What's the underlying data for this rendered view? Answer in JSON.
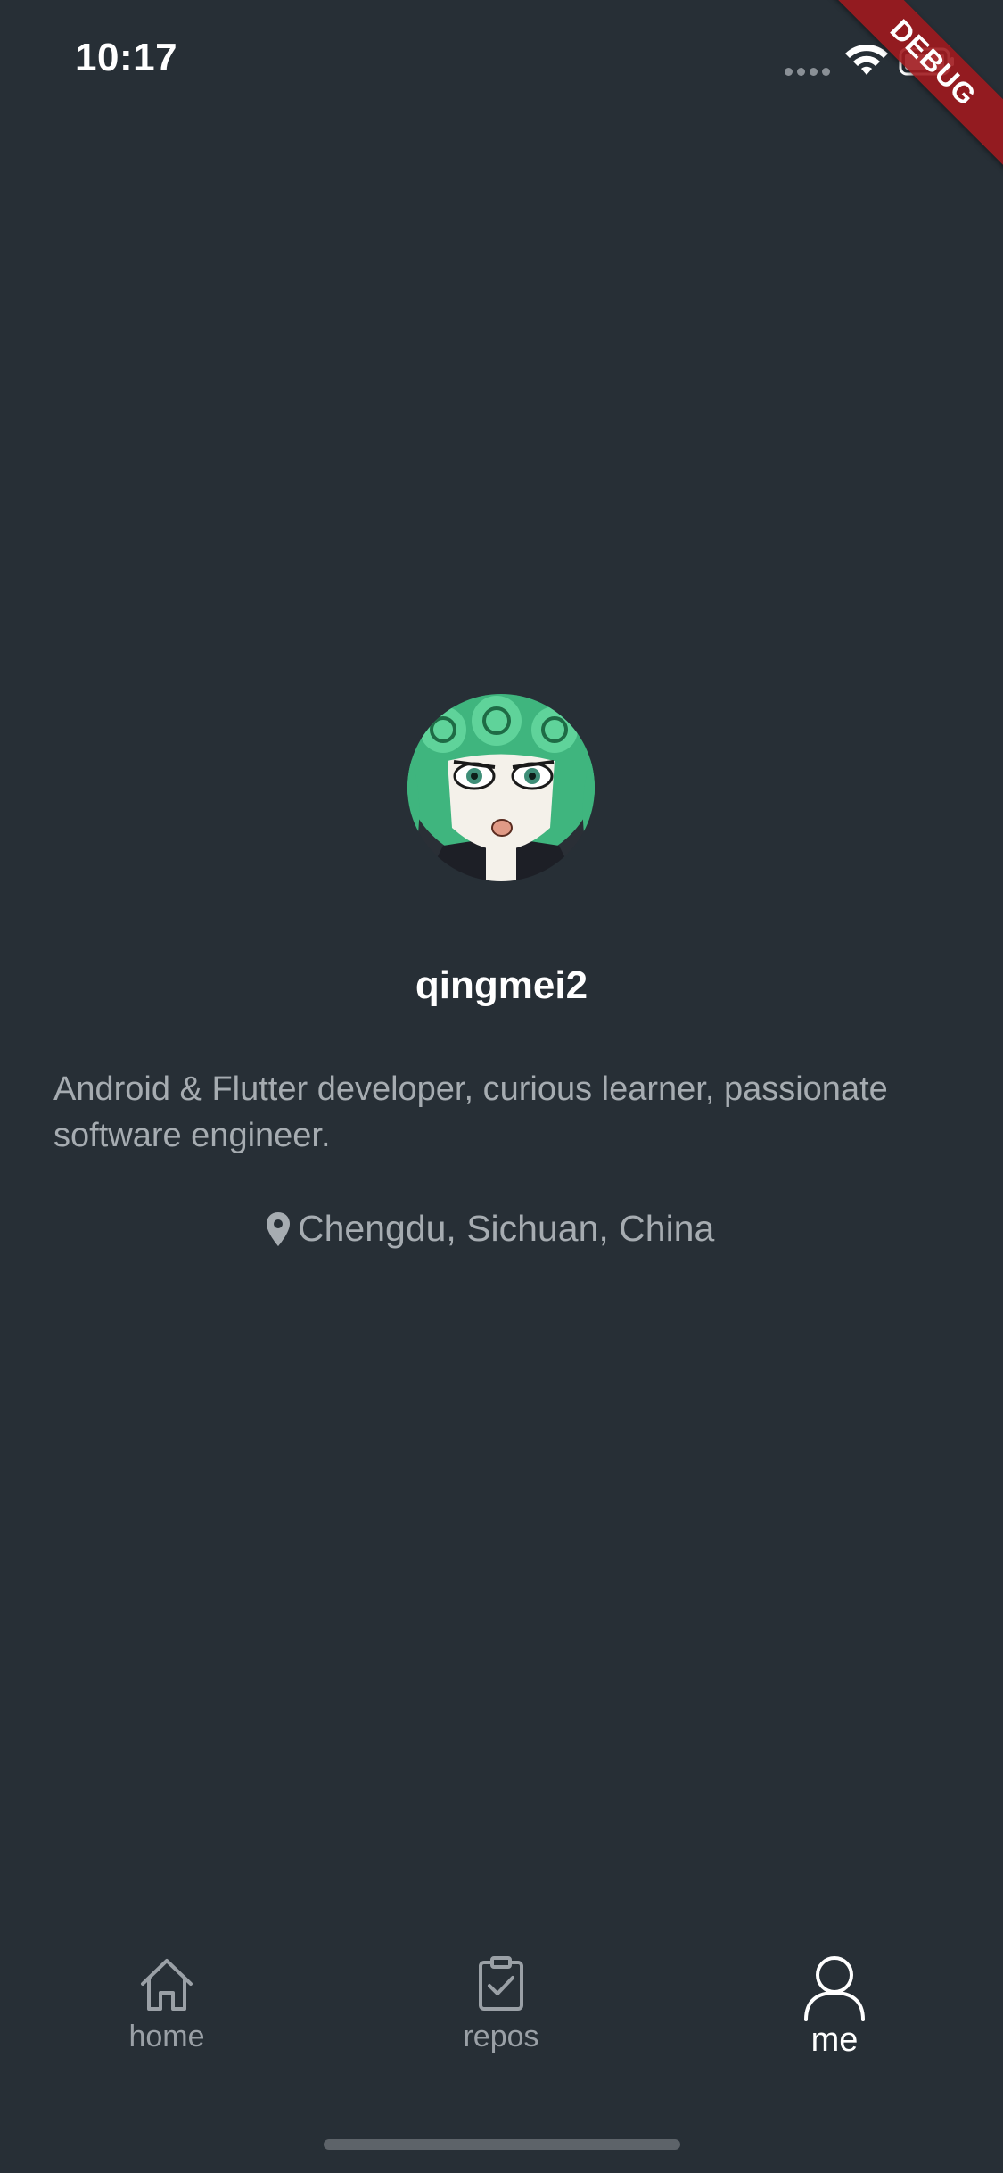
{
  "status_bar": {
    "time": "10:17"
  },
  "debug_banner": {
    "label": "DEBUG",
    "color": "#a01a1e"
  },
  "profile": {
    "username": "qingmei2",
    "bio": "Android & Flutter developer, curious learner, passionate software engineer.",
    "location": "Chengdu, Sichuan, China",
    "avatar_icon": "avatar-image"
  },
  "bottom_nav": {
    "items": [
      {
        "label": "home",
        "icon": "home-icon",
        "active": false
      },
      {
        "label": "repos",
        "icon": "clipboard-check-icon",
        "active": false
      },
      {
        "label": "me",
        "icon": "person-icon",
        "active": true
      }
    ]
  },
  "colors": {
    "background": "#272f36",
    "text_primary": "#ffffff",
    "text_secondary": "#a6acb1",
    "nav_inactive": "#9aa0a6"
  }
}
